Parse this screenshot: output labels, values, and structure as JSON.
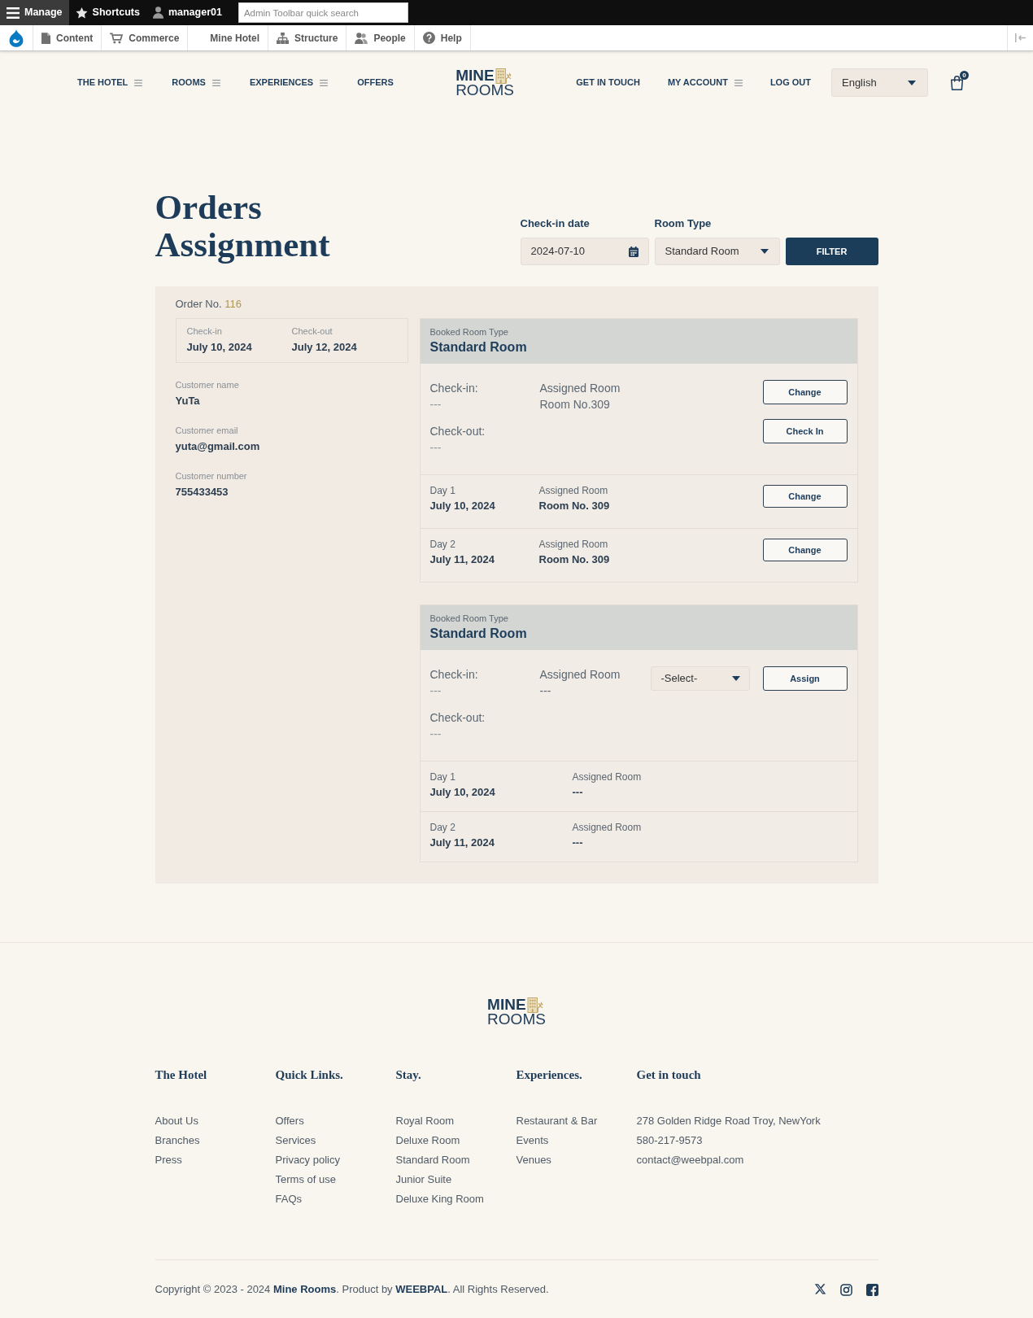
{
  "admin_toolbar": {
    "items": [
      {
        "label": "Manage",
        "selected": true
      },
      {
        "label": "Shortcuts",
        "selected": false
      },
      {
        "label": "manager01",
        "selected": false
      }
    ],
    "search": {
      "placeholder": "Admin Toolbar quick search"
    }
  },
  "admin_menu": {
    "items": [
      {
        "label": "Content"
      },
      {
        "label": "Commerce"
      },
      {
        "label": "Mine Hotel"
      },
      {
        "label": "Structure"
      },
      {
        "label": "People"
      },
      {
        "label": "Help"
      }
    ]
  },
  "header": {
    "nav_left": [
      {
        "label": "THE HOTEL",
        "submenu": true
      },
      {
        "label": "ROOMS",
        "submenu": true
      },
      {
        "label": "EXPERIENCES",
        "submenu": true
      },
      {
        "label": "OFFERS",
        "submenu": false
      }
    ],
    "logo": {
      "line_1": "MINE",
      "line_2": "ROOMS"
    },
    "nav_right": [
      {
        "label": "GET IN TOUCH",
        "submenu": false
      },
      {
        "label": "MY ACCOUNT",
        "submenu": true
      },
      {
        "label": "LOG OUT",
        "submenu": false
      }
    ],
    "language": {
      "value": "English"
    },
    "cart": {
      "count": "0"
    }
  },
  "page": {
    "title": "Orders Assignment",
    "filters": [
      {
        "kind": "date",
        "label": "Check-in date",
        "value": "2024-07-10"
      },
      {
        "kind": "select",
        "label": "Room Type",
        "value": "Standard Room"
      }
    ],
    "filter_button": "FILTER"
  },
  "order": {
    "label": "Order No.",
    "number": "116",
    "stay": [
      {
        "label": "Check-in",
        "value": "July 10, 2024"
      },
      {
        "label": "Check-out",
        "value": "July 12, 2024"
      }
    ],
    "customer": [
      {
        "label": "Customer name",
        "value": "YuTa"
      },
      {
        "label": "Customer email",
        "value": "yuta@gmail.com"
      },
      {
        "label": "Customer number",
        "value": "755433453"
      }
    ],
    "rooms": [
      {
        "type_label": "Booked Room Type",
        "type": "Standard Room",
        "check_in": {
          "label": "Check-in:",
          "value": "---"
        },
        "check_out": {
          "label": "Check-out:",
          "value": "---"
        },
        "assigned": {
          "label": "Assigned Room",
          "value": "Room No.309"
        },
        "actions": [
          {
            "kind": "button",
            "label": "Change"
          },
          {
            "kind": "button",
            "label": "Check In"
          }
        ],
        "days": [
          {
            "label": "Day 1",
            "date": "July 10, 2024",
            "assigned_label": "Assigned Room",
            "assigned": "Room No. 309",
            "button": "Change"
          },
          {
            "label": "Day 2",
            "date": "July 11, 2024",
            "assigned_label": "Assigned Room",
            "assigned": "Room No. 309",
            "button": "Change"
          }
        ]
      },
      {
        "type_label": "Booked Room Type",
        "type": "Standard Room",
        "check_in": {
          "label": "Check-in:",
          "value": "---"
        },
        "check_out": {
          "label": "Check-out:",
          "value": "---"
        },
        "assigned": {
          "label": "Assigned Room",
          "value": "---"
        },
        "actions": [
          {
            "kind": "select",
            "value": "-Select-"
          },
          {
            "kind": "button",
            "label": "Assign"
          }
        ],
        "days": [
          {
            "label": "Day 1",
            "date": "July 10, 2024",
            "assigned_label": "Assigned Room",
            "assigned": "---"
          },
          {
            "label": "Day 2",
            "date": "July 11, 2024",
            "assigned_label": "Assigned Room",
            "assigned": "---"
          }
        ]
      }
    ]
  },
  "footer": {
    "logo": {
      "line_1": "MINE",
      "line_2": "ROOMS"
    },
    "columns": [
      {
        "heading": "The Hotel",
        "links": [
          "About Us",
          "Branches",
          "Press"
        ]
      },
      {
        "heading": "Quick Links.",
        "links": [
          "Offers",
          "Services",
          "Privacy policy",
          "Terms of use",
          "FAQs"
        ]
      },
      {
        "heading": "Stay.",
        "links": [
          "Royal Room",
          "Deluxe Room",
          "Standard Room",
          "Junior Suite",
          "Deluxe King Room"
        ]
      },
      {
        "heading": "Experiences.",
        "links": [
          "Restaurant & Bar",
          "Events",
          "Venues"
        ]
      },
      {
        "heading": "Get in touch",
        "links": [
          "278 Golden Ridge Road Troy, NewYork",
          "580-217-9573",
          "contact@weebpal.com"
        ]
      }
    ],
    "copyright": "Copyright © 2023 - 2024 **Mine Rooms**. Product by **WEEBPAL**. All Rights Reserved."
  }
}
